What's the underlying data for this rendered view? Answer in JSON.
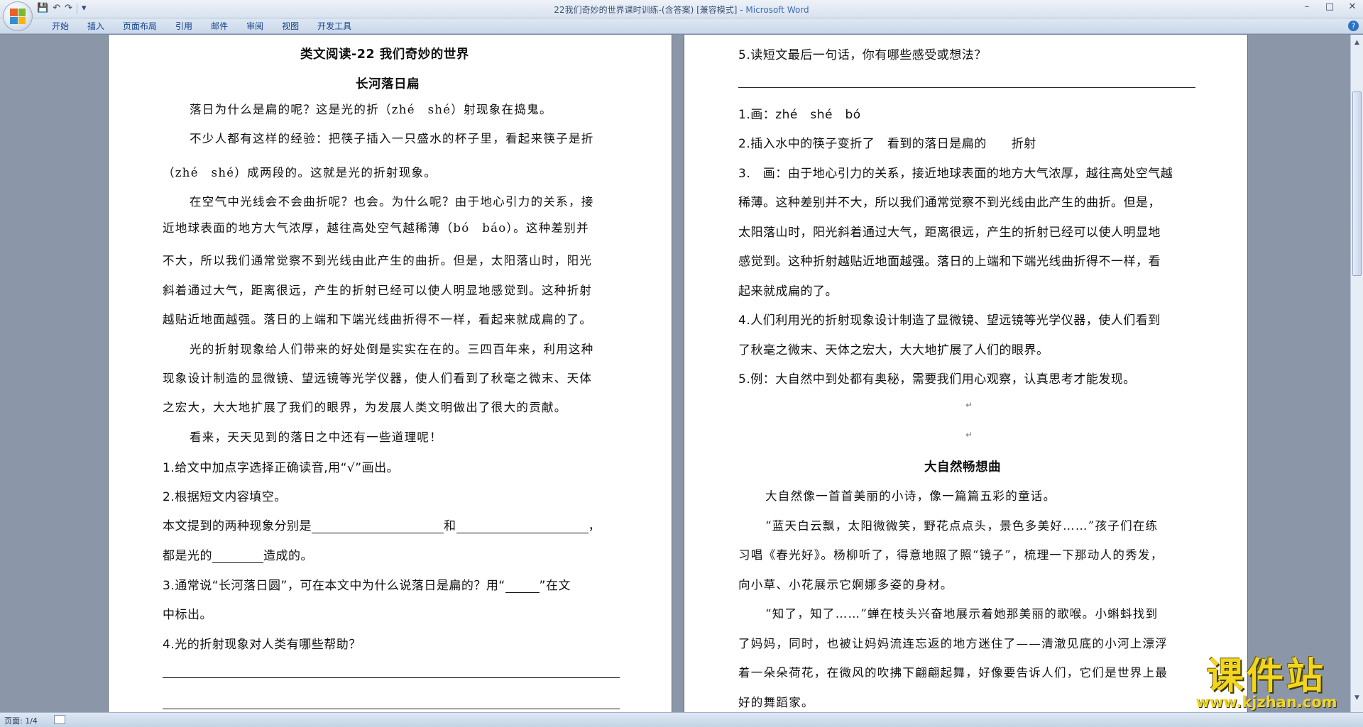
{
  "window": {
    "title": "22我们奇妙的世界课时训练-(含答案) [兼容模式] - ",
    "app_name": "Microsoft Word",
    "controls": [
      "–",
      "□",
      "✕"
    ]
  },
  "ribbon": {
    "tabs": [
      "开始",
      "插入",
      "页面布局",
      "引用",
      "邮件",
      "审阅",
      "视图",
      "开发工具"
    ]
  },
  "left_page": {
    "title": "类文阅读-22 我们奇妙的世界",
    "subtitle": "长河落日扁",
    "lines": [
      "落日为什么是扁的呢？这是光的折（zhé　shé）射现象在捣鬼。",
      "不少人都有这样的经验：把筷子插入一只盛水的杯子里，看起来筷子是折",
      "（zhé　shé）成两段的。这就是光的折射现象。",
      "在空气中光线会不会曲折呢？也会。为什么呢？由于地心引力的关系，接",
      "近地球表面的地方大气浓厚，越往高处空气越稀薄（bó　báo）。这种差别并",
      "不大，所以我们通常觉察不到光线由此产生的曲折。但是，太阳落山时，阳光",
      "斜着通过大气，距离很远，产生的折射已经可以使人明显地感觉到。这种折射",
      "越贴近地面越强。落日的上端和下端光线曲折得不一样，看起来就成扁的了。",
      "光的折射现象给人们带来的好处倒是实实在在的。三四百年来，利用这种",
      "现象设计制造的显微镜、望远镜等光学仪器，使人们看到了秋毫之微末、天体",
      "之宏大，大大地扩展了我们的眼界，为发展人类文明做出了很大的贡献。",
      "看来，天天见到的落日之中还有一些道理呢！"
    ],
    "questions": [
      "1.给文中加点字选择正确读音,用“√”画出。",
      "2.根据短文内容填空。",
      "本文提到的两种现象分别是",
      "和",
      "，",
      "都是光的",
      "造成的。",
      "3.通常说“长河落日圆”，可在本文中为什么说落日是扁的？用“",
      "”在文",
      "中标出。",
      "4.光的折射现象对人类有哪些帮助？"
    ]
  },
  "right_page": {
    "q5": "5.读短文最后一句话，你有哪些感受或想法？",
    "answers": [
      "1.画：zhé　shé　bó",
      "2.插入水中的筷子变折了　看到的落日是扁的　　折射",
      "3.　画：由于地心引力的关系，接近地球表面的地方大气浓厚，越往高处空气越",
      "稀薄。这种差别并不大，所以我们通常觉察不到光线由此产生的曲折。但是，",
      "太阳落山时，阳光斜着通过大气，距离很远，产生的折射已经可以使人明显地",
      "感觉到。这种折射越贴近地面越强。落日的上端和下端光线曲折得不一样，看",
      "起来就成扁的了。",
      "4.人们利用光的折射现象设计制造了显微镜、望远镜等光学仪器，使人们看到",
      "了秋毫之微末、天体之宏大，大大地扩展了人们的眼界。",
      "5.例：大自然中到处都有奥秘，需要我们用心观察，认真思考才能发现。"
    ],
    "section2_title": "大自然畅想曲",
    "section2_lines": [
      "大自然像一首首美丽的小诗，像一篇篇五彩的童话。",
      "“蓝天白云飘，太阳微微笑，野花点点头，景色多美好……”孩子们在练",
      "习唱《春光好》。杨柳听了，得意地照了照“镜子”，梳理一下那动人的秀发，",
      "向小草、小花展示它婀娜多姿的身材。",
      "“知了，知了……”蝉在枝头兴奋地展示着她那美丽的歌喉。小蝌蚪找到",
      "了妈妈，同时，也被让妈妈流连忘返的地方迷住了——清澈见底的小河上漂浮",
      "着一朵朵荷花，在微风的吹拂下翩翩起舞，好像要告诉人们，它们是世界上最",
      "好的舞蹈家。"
    ]
  },
  "status": {
    "page": "页面: 1/4"
  },
  "watermark": {
    "name": "课件站",
    "url": "www.kjzhan.com"
  }
}
